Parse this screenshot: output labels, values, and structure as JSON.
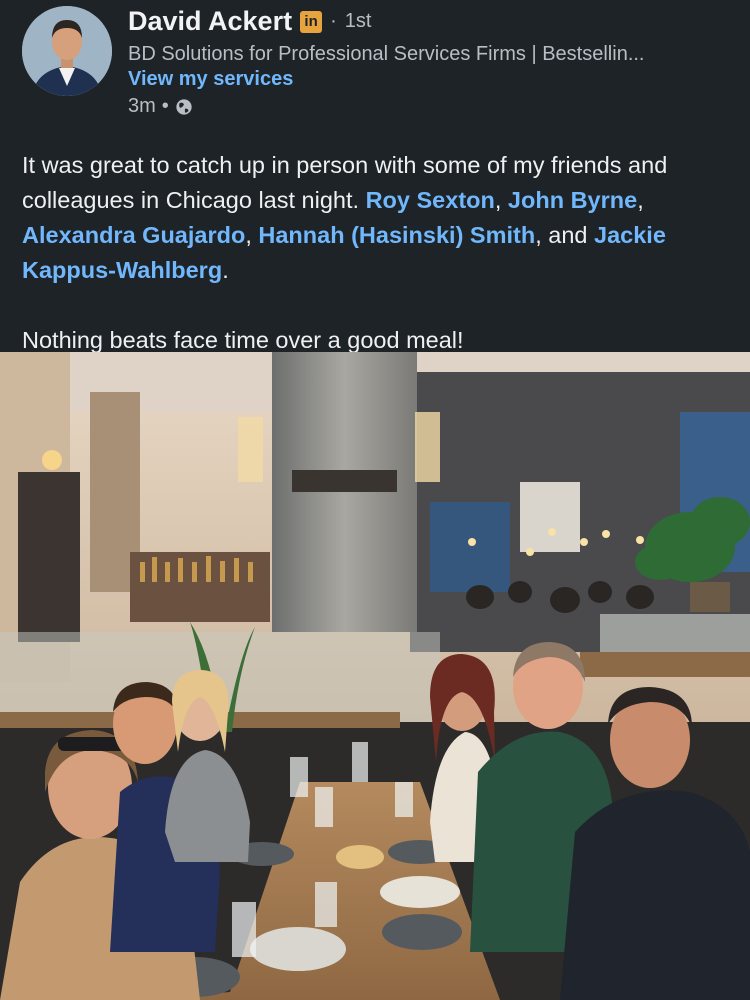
{
  "author": {
    "name": "David Ackert",
    "badge": "in",
    "degree_sep": "·",
    "degree": "1st",
    "headline": "BD Solutions for Professional Services Firms | Bestsellin...",
    "services_link": "View my services",
    "time": "3m",
    "time_sep": "•",
    "visibility_icon": "globe-icon"
  },
  "post": {
    "p1_lead": "It was great to catch up in person with some of my friends and colleagues in Chicago last night. ",
    "mentions": [
      "Roy Sexton",
      "John Byrne",
      "Alexandra Guajardo",
      "Hannah (Hasinski) Smith",
      "Jackie Kappus-Wahlberg"
    ],
    "sep_comma": ", ",
    "sep_and": ", and ",
    "end": ".",
    "p2": "Nothing beats face time over a good meal!"
  },
  "colors": {
    "background": "#1e2328",
    "link": "#71b7fb",
    "badge": "#e7a33e"
  }
}
